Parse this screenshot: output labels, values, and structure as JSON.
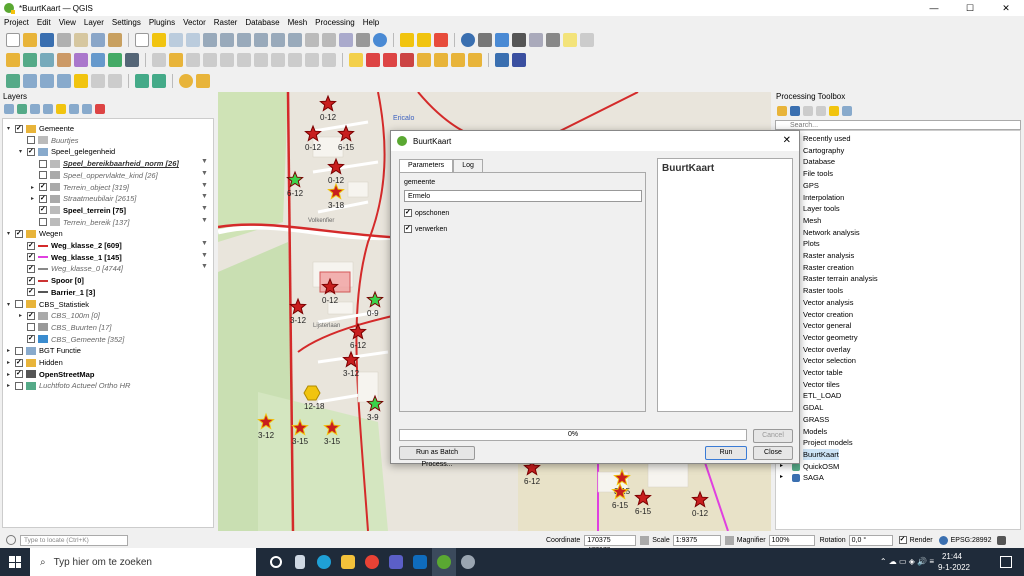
{
  "window": {
    "title": "*BuurtKaart — QGIS"
  },
  "menu": [
    "Project",
    "Edit",
    "View",
    "Layer",
    "Settings",
    "Plugins",
    "Vector",
    "Raster",
    "Database",
    "Mesh",
    "Processing",
    "Help"
  ],
  "layers_panel": {
    "title": "Layers",
    "rows": [
      {
        "label": "Gemeente",
        "checked": true,
        "expanded": true,
        "indent": 0,
        "style": "normal"
      },
      {
        "label": "Buurtjes",
        "checked": false,
        "indent": 1,
        "style": "it"
      },
      {
        "label": "Speel_gelegenheid",
        "checked": true,
        "expanded": true,
        "indent": 1,
        "style": "normal"
      },
      {
        "label": "Speel_bereikbaarheid_norm [26]",
        "checked": false,
        "indent": 2,
        "style": "itb"
      },
      {
        "label": "Speel_oppervlakte_kind [26]",
        "checked": false,
        "indent": 2,
        "style": "it"
      },
      {
        "label": "Terrein_object [319]",
        "checked": true,
        "indent": 2,
        "style": "it"
      },
      {
        "label": "Straatmeubilair [2615]",
        "checked": true,
        "indent": 2,
        "style": "it"
      },
      {
        "label": "Speel_terrein [75]",
        "checked": true,
        "indent": 2,
        "style": "b"
      },
      {
        "label": "Terrein_bereik [137]",
        "checked": false,
        "indent": 2,
        "style": "it"
      },
      {
        "label": "Wegen",
        "checked": true,
        "expanded": true,
        "indent": 0,
        "style": "normal"
      },
      {
        "label": "Weg_klasse_2 [609]",
        "checked": true,
        "indent": 1,
        "style": "b"
      },
      {
        "label": "Weg_klasse_1 [145]",
        "checked": true,
        "indent": 1,
        "style": "b"
      },
      {
        "label": "Weg_klasse_0 [4744]",
        "checked": true,
        "indent": 1,
        "style": "it"
      },
      {
        "label": "Spoor [0]",
        "checked": true,
        "indent": 1,
        "style": "b"
      },
      {
        "label": "Barrier_1 [3]",
        "checked": true,
        "indent": 1,
        "style": "b"
      },
      {
        "label": "CBS_Statistiek",
        "checked": false,
        "expanded": true,
        "indent": 0,
        "style": "normal"
      },
      {
        "label": "CBS_100m [0]",
        "checked": true,
        "indent": 1,
        "style": "it"
      },
      {
        "label": "CBS_Buurten [17]",
        "checked": false,
        "indent": 1,
        "style": "it"
      },
      {
        "label": "CBS_Gemeente [352]",
        "checked": true,
        "indent": 1,
        "style": "it"
      },
      {
        "label": "BGT Functie",
        "checked": false,
        "indent": 0,
        "style": "normal"
      },
      {
        "label": "Hidden",
        "checked": true,
        "indent": 0,
        "style": "normal"
      },
      {
        "label": "OpenStreetMap",
        "checked": true,
        "indent": 0,
        "style": "b"
      },
      {
        "label": "Luchtfoto Actueel Ortho HR",
        "checked": false,
        "indent": 0,
        "style": "it"
      }
    ]
  },
  "processing": {
    "title": "Processing Toolbox",
    "search_placeholder": "Search...",
    "items": [
      "Recently used",
      "Cartography",
      "Database",
      "File tools",
      "GPS",
      "Interpolation",
      "Layer tools",
      "Mesh",
      "Network analysis",
      "Plots",
      "Raster analysis",
      "Raster creation",
      "Raster terrain analysis",
      "Raster tools",
      "Vector analysis",
      "Vector creation",
      "Vector general",
      "Vector geometry",
      "Vector overlay",
      "Vector selection",
      "Vector table",
      "Vector tiles",
      "ETL_LOAD",
      "GDAL",
      "GRASS",
      "Models",
      "Project models",
      "BuurtKaart",
      "QuickOSM",
      "SAGA"
    ]
  },
  "dialog": {
    "title": "BuurtKaart",
    "tab_parameters": "Parameters",
    "tab_log": "Log",
    "field_label": "gemeente",
    "field_value": "Ermelo",
    "check1": "opschonen",
    "check2": "verwerken",
    "help_title": "BuurtKaart",
    "progress": "0%",
    "cancel": "Cancel",
    "batch": "Run as Batch Process...",
    "run": "Run",
    "close": "Close"
  },
  "map_labels": [
    {
      "t": "0-12"
    },
    {
      "t": "0-12"
    },
    {
      "t": "6-15"
    },
    {
      "t": "0-12"
    },
    {
      "t": "6-12"
    },
    {
      "t": "3-18"
    },
    {
      "t": "0-12"
    },
    {
      "t": "0-9"
    },
    {
      "t": "3-12"
    },
    {
      "t": "6-12"
    },
    {
      "t": "3-12"
    },
    {
      "t": "12-18"
    },
    {
      "t": "3-9"
    },
    {
      "t": "3-12"
    },
    {
      "t": "3-15"
    },
    {
      "t": "3-15"
    },
    {
      "t": "6-12"
    },
    {
      "t": "3-15"
    },
    {
      "t": "6-15"
    },
    {
      "t": "6-15"
    },
    {
      "t": "0-12"
    }
  ],
  "map_street_labels": [
    "Ericalo",
    "Volkenfier",
    "Lijsterlaan"
  ],
  "status": {
    "locate_placeholder": "Type to locate (Ctrl+K)",
    "coordinate_label": "Coordinate",
    "coordinate": "170375 477679",
    "scale_label": "Scale",
    "scale": "1:9375",
    "magnifier_label": "Magnifier",
    "magnifier": "100%",
    "rotation_label": "Rotation",
    "rotation": "0,0 °",
    "render": "Render",
    "crs": "EPSG:28992"
  },
  "taskbar": {
    "search": "Typ hier om te zoeken",
    "time": "21:44",
    "date": "9-1-2022"
  }
}
